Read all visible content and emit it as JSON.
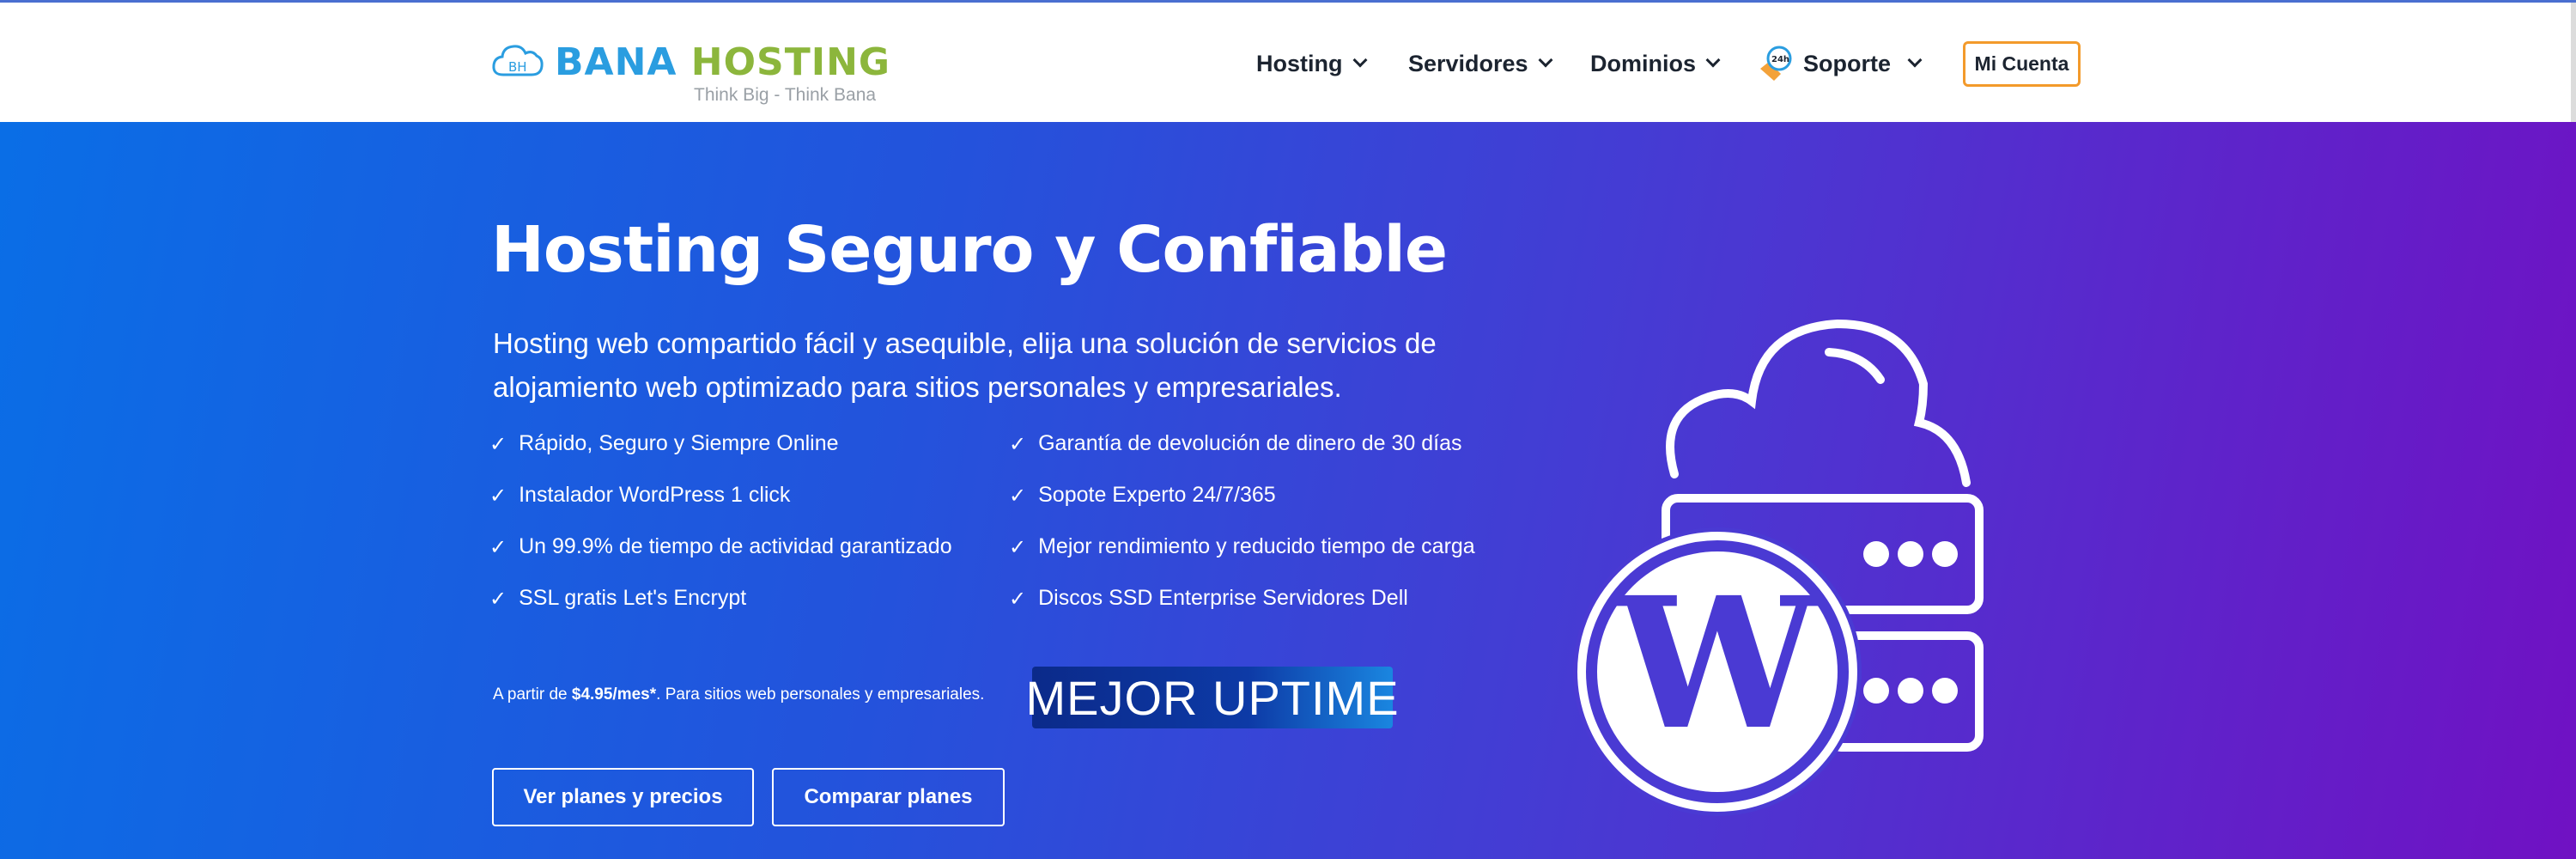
{
  "header": {
    "logo": {
      "monogram": "BH",
      "name_part1": "BANA",
      "name_part2": "HOSTING",
      "tagline": "Think Big - Think Bana"
    },
    "nav": [
      {
        "label": "Hosting",
        "has_dropdown": true
      },
      {
        "label": "Servidores",
        "has_dropdown": true
      },
      {
        "label": "Dominios",
        "has_dropdown": true
      },
      {
        "label": "Soporte",
        "has_dropdown": true,
        "icon": "24h-support-icon",
        "icon_text": "24h"
      }
    ],
    "account_button": "Mi Cuenta"
  },
  "hero": {
    "title": "Hosting Seguro y Confiable",
    "description": "Hosting web compartido fácil y asequible, elija una solución de servicios de alojamiento web optimizado para sitios personales y empresariales.",
    "check_symbol": "✓",
    "features_left": [
      "Rápido, Seguro y Siempre Online",
      "Instalador WordPress 1 click",
      "Un 99.9% de tiempo de actividad garantizado",
      "SSL gratis Let's Encrypt"
    ],
    "features_right": [
      "Garantía de devolución de dinero de 30 días",
      "Sopote Experto 24/7/365",
      "Mejor rendimiento y reducido tiempo de carga",
      "Discos SSD Enterprise Servidores Dell"
    ],
    "price_prefix": "A partir de ",
    "price": "$4.95/mes*",
    "price_suffix": ". Para sitios web personales y empresariales.",
    "badge": "MEJOR UPTIME",
    "buttons": {
      "plans": "Ver planes y precios",
      "compare": "Comparar planes"
    }
  },
  "colors": {
    "brand_blue": "#2a9de0",
    "brand_green": "#8cb63c",
    "accent_orange": "#f39a2b",
    "hero_gradient_start": "#0a6ee6",
    "hero_gradient_end": "#7011c3"
  }
}
